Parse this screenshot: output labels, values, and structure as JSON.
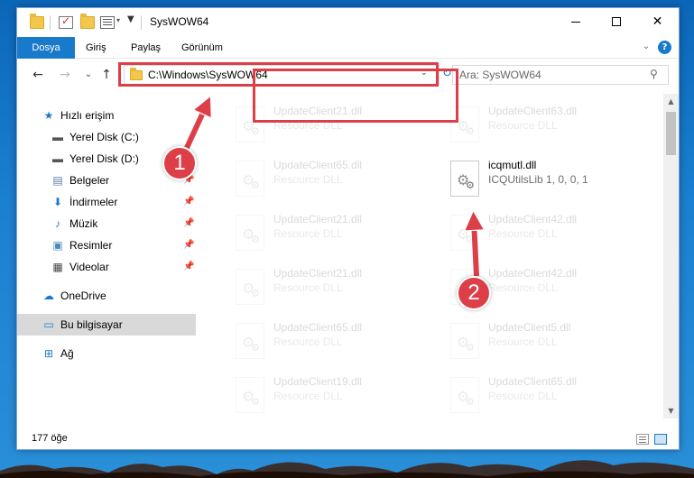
{
  "window": {
    "title": "SysWOW64",
    "minimize_glyph": "",
    "close_glyph": "✕"
  },
  "ribbon": {
    "tabs": [
      "Dosya",
      "Giriş",
      "Paylaş",
      "Görünüm"
    ],
    "expand_glyph": "⌄",
    "help_glyph": "?"
  },
  "nav": {
    "back_glyph": "←",
    "forward_glyph": "→",
    "recent_glyph": "⌄",
    "up_glyph": "↑",
    "address": "C:\\Windows\\SysWOW64",
    "address_drop_glyph": "⌄",
    "refresh_glyph": "↻",
    "search_placeholder": "Ara: SysWOW64",
    "search_glyph": "⚲"
  },
  "sidebar": {
    "items": [
      {
        "label": "Hızlı erişim",
        "icon": "star-icon",
        "glyph": "★",
        "color": "#1979ca",
        "pinned": false
      },
      {
        "label": "Yerel Disk (C:)",
        "icon": "drive-icon",
        "glyph": "▬",
        "color": "#555555",
        "pinned": false
      },
      {
        "label": "Yerel Disk (D:)",
        "icon": "drive-icon",
        "glyph": "▬",
        "color": "#555555",
        "pinned": false
      },
      {
        "label": "Belgeler",
        "icon": "document-icon",
        "glyph": "▤",
        "color": "#5a7fa8",
        "pinned": true
      },
      {
        "label": "İndirmeler",
        "icon": "download-icon",
        "glyph": "⬇",
        "color": "#1979ca",
        "pinned": true
      },
      {
        "label": "Müzik",
        "icon": "music-icon",
        "glyph": "♪",
        "color": "#1979ca",
        "pinned": true
      },
      {
        "label": "Resimler",
        "icon": "pictures-icon",
        "glyph": "▣",
        "color": "#4a8bc2",
        "pinned": true
      },
      {
        "label": "Videolar",
        "icon": "video-icon",
        "glyph": "▦",
        "color": "#444444",
        "pinned": true
      },
      {
        "label": "OneDrive",
        "icon": "cloud-icon",
        "glyph": "☁",
        "color": "#1979ca",
        "pinned": false
      },
      {
        "label": "Bu bilgisayar",
        "icon": "computer-icon",
        "glyph": "▭",
        "color": "#1979ca",
        "pinned": false,
        "selected": true
      },
      {
        "label": "Ağ",
        "icon": "network-icon",
        "glyph": "⊞",
        "color": "#1979ca",
        "pinned": false
      }
    ],
    "pin_glyph": "📌"
  },
  "files": [
    {
      "name": "UpdateClient21.dll",
      "desc": "Resource DLL",
      "faded": true
    },
    {
      "name": "UpdateClient63.dll",
      "desc": "Resource DLL",
      "faded": true
    },
    {
      "name": "UpdateClient65.dll",
      "desc": "Resource DLL",
      "faded": true
    },
    {
      "name": "icqmutl.dll",
      "desc": "ICQUtilsLib 1, 0, 0, 1",
      "faded": false
    },
    {
      "name": "UpdateClient21.dll",
      "desc": "Resource DLL",
      "faded": true
    },
    {
      "name": "UpdateClient42.dll",
      "desc": "Resource DLL",
      "faded": true
    },
    {
      "name": "UpdateClient21.dll",
      "desc": "Resource DLL",
      "faded": true
    },
    {
      "name": "UpdateClient42.dll",
      "desc": "Resource DLL",
      "faded": true
    },
    {
      "name": "UpdateClient65.dll",
      "desc": "Resource DLL",
      "faded": true
    },
    {
      "name": "UpdateClient5.dll",
      "desc": "Resource DLL",
      "faded": true
    },
    {
      "name": "UpdateClient19.dll",
      "desc": "Resource DLL",
      "faded": true
    },
    {
      "name": "UpdateClient65.dll",
      "desc": "Resource DLL",
      "faded": true
    }
  ],
  "status": {
    "count": "177 öğe"
  },
  "annotations": {
    "badge1": "1",
    "badge2": "2",
    "highlight_color": "#dc3f48"
  },
  "colors": {
    "accent": "#1979ca",
    "selection": "#d9d9d9",
    "desktop": "#1a7fd0"
  }
}
